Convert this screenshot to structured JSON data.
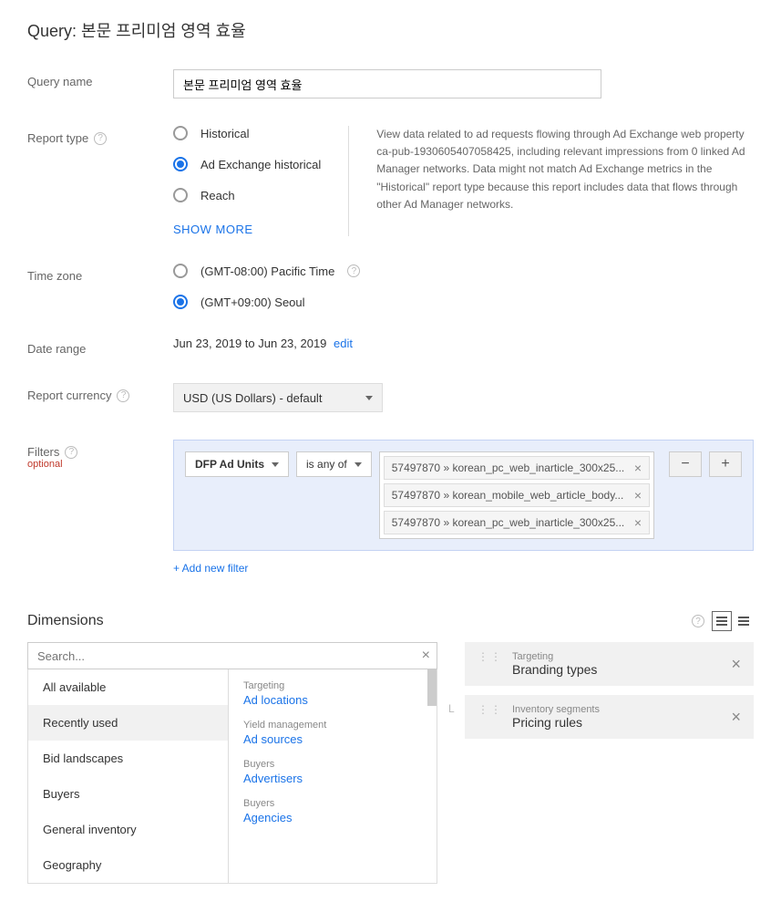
{
  "page_title_prefix": "Query:",
  "page_title_value": "본문 프리미엄 영역 효율",
  "labels": {
    "query_name": "Query name",
    "report_type": "Report type",
    "time_zone": "Time zone",
    "date_range": "Date range",
    "report_currency": "Report currency",
    "filters": "Filters",
    "optional": "optional",
    "dimensions": "Dimensions"
  },
  "query_name_value": "본문 프리미엄 영역 효율",
  "report_type": {
    "options": [
      "Historical",
      "Ad Exchange historical",
      "Reach"
    ],
    "selected": "Ad Exchange historical",
    "show_more": "SHOW MORE",
    "description": "View data related to ad requests flowing through Ad Exchange web property ca-pub-1930605407058425, including relevant impressions from 0 linked Ad Manager networks. Data might not match Ad Exchange metrics in the \"Historical\" report type because this report includes data that flows through other Ad Manager networks."
  },
  "time_zone": {
    "options": [
      "(GMT-08:00) Pacific Time",
      "(GMT+09:00) Seoul"
    ],
    "selected": "(GMT+09:00) Seoul"
  },
  "date_range_text": "Jun 23, 2019 to Jun 23, 2019",
  "date_range_edit": "edit",
  "currency_selected": "USD (US Dollars) - default",
  "filters_panel": {
    "dimension": "DFP Ad Units",
    "operator": "is any of",
    "chips": [
      "57497870 » korean_pc_web_inarticle_300x25...",
      "57497870 » korean_mobile_web_article_body...",
      "57497870 » korean_pc_web_inarticle_300x25..."
    ],
    "add_filter": "+ Add new filter"
  },
  "dimensions_panel": {
    "search_placeholder": "Search...",
    "categories": [
      "All available",
      "Recently used",
      "Bid landscapes",
      "Buyers",
      "General inventory",
      "Geography"
    ],
    "active_category": "Recently used",
    "sub_items": [
      {
        "group": "Targeting",
        "name": "Ad locations"
      },
      {
        "group": "Yield management",
        "name": "Ad sources"
      },
      {
        "group": "Buyers",
        "name": "Advertisers"
      },
      {
        "group": "Buyers",
        "name": "Agencies"
      }
    ],
    "selected": [
      {
        "group": "Targeting",
        "name": "Branding types"
      },
      {
        "group": "Inventory segments",
        "name": "Pricing rules"
      }
    ]
  }
}
